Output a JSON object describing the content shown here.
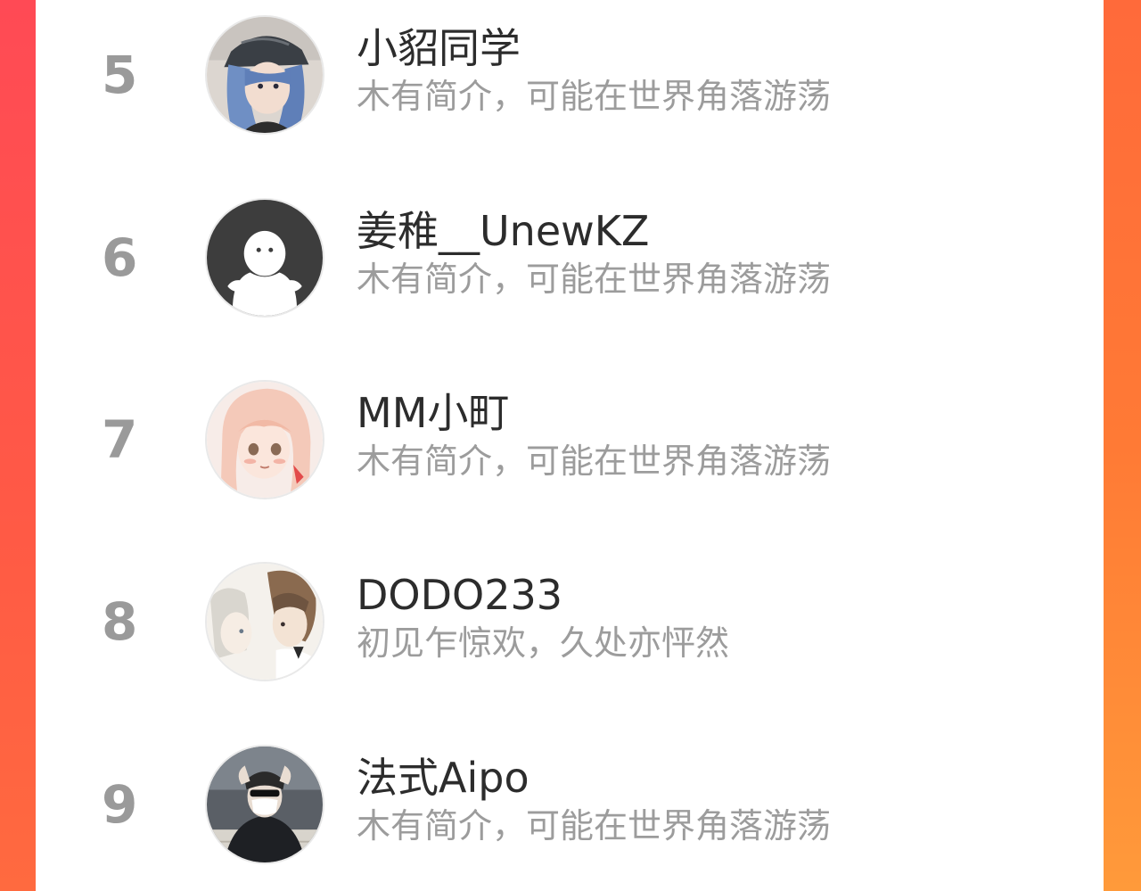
{
  "colors": {
    "rank": "#9a9a9a",
    "name": "#2c2c2c",
    "bio": "#9c9c9c",
    "background_left": "#ff4a55",
    "background_right": "#ff8a36"
  },
  "users": [
    {
      "rank": "5",
      "name": "小貂同学",
      "bio": "木有简介，可能在世界角落游荡",
      "avatar_icon": "anime-character-cap-avatar"
    },
    {
      "rank": "6",
      "name": "姜稚__UnewKZ",
      "bio": "木有简介，可能在世界角落游荡",
      "avatar_icon": "default-user-avatar"
    },
    {
      "rank": "7",
      "name": "MM小町",
      "bio": "木有简介，可能在世界角落游荡",
      "avatar_icon": "anime-girl-avatar"
    },
    {
      "rank": "8",
      "name": "DODO233",
      "bio": "初见乍惊欢，久处亦怦然",
      "avatar_icon": "anime-couple-avatar"
    },
    {
      "rank": "9",
      "name": "法式Aipo",
      "bio": "木有简介，可能在世界角落游荡",
      "avatar_icon": "masked-person-photo-avatar"
    }
  ]
}
